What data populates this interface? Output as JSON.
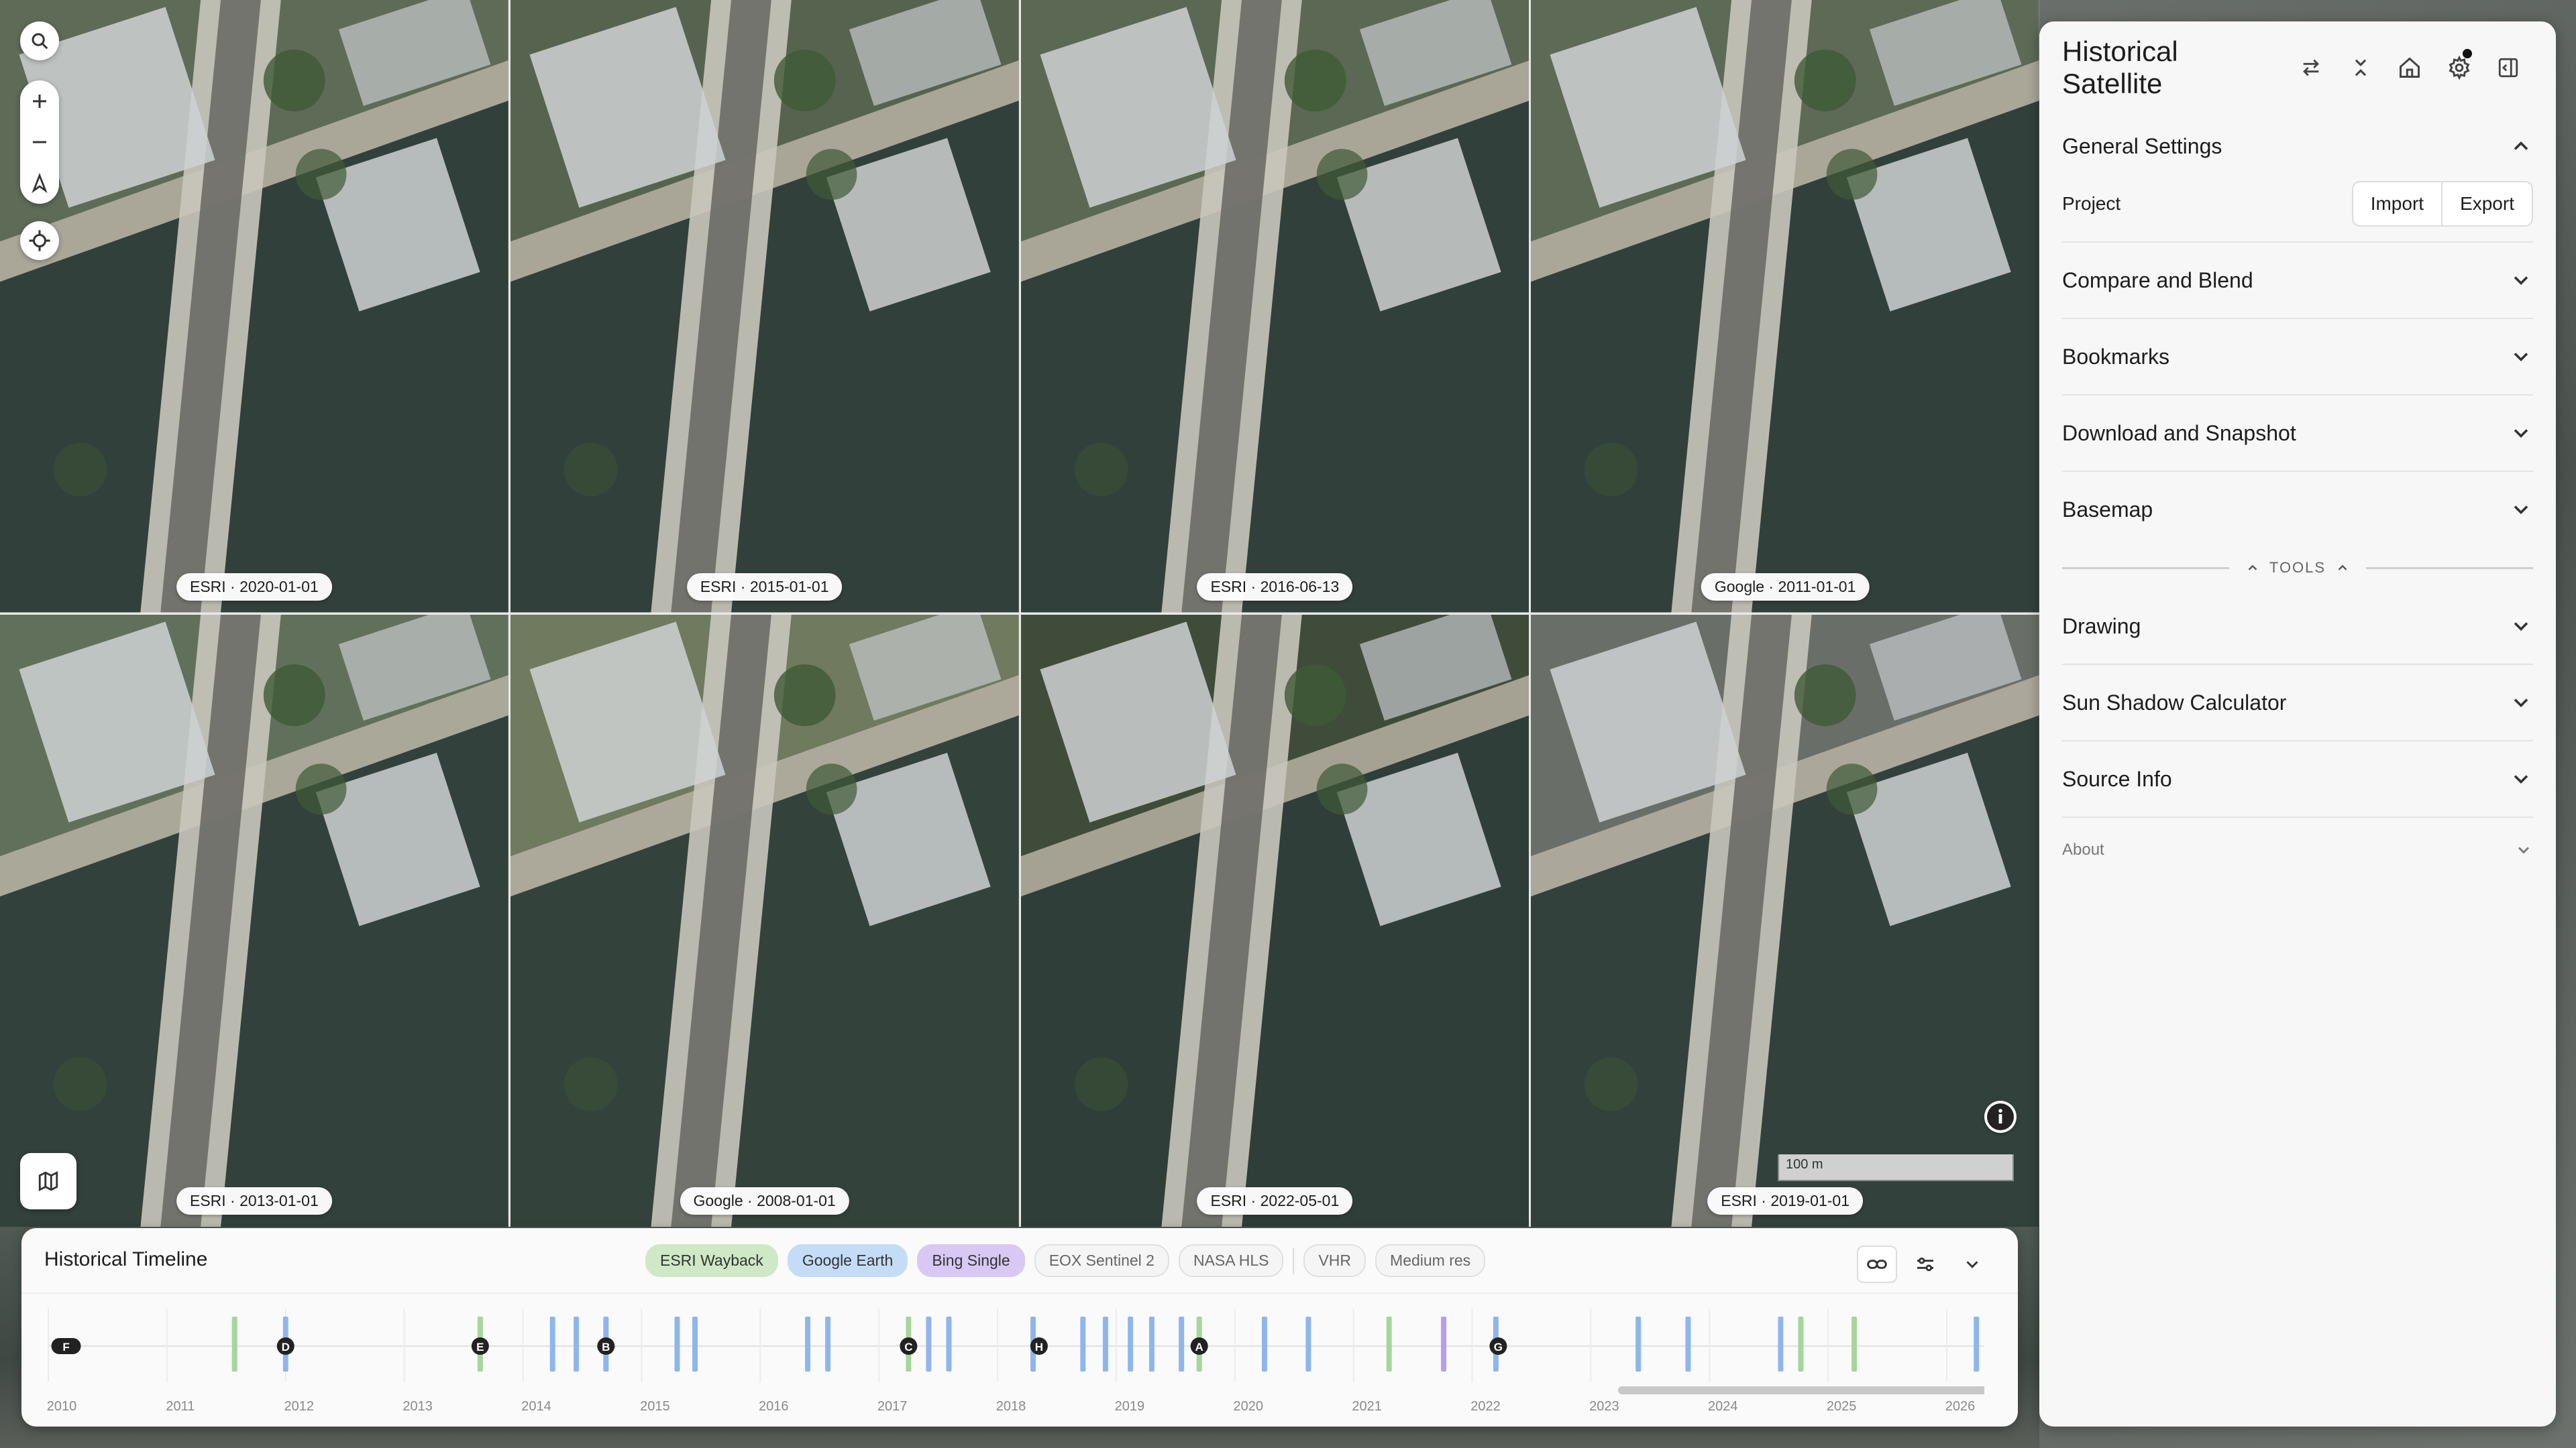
{
  "tiles": [
    {
      "label": "ESRI · 2020-01-01",
      "tone": "#5e6b57"
    },
    {
      "label": "ESRI · 2015-01-01",
      "tone": "#56644f"
    },
    {
      "label": "ESRI · 2016-06-13",
      "tone": "#5b6853"
    },
    {
      "label": "Google · 2011-01-01",
      "tone": "#5d6a56"
    },
    {
      "label": "ESRI · 2013-01-01",
      "tone": "#61705a"
    },
    {
      "label": "Google · 2008-01-01",
      "tone": "#6f7a5e"
    },
    {
      "label": "ESRI · 2022-05-01",
      "tone": "#3f4c3a"
    },
    {
      "label": "ESRI · 2019-01-01",
      "tone": "#6a6e68"
    }
  ],
  "map": {
    "scale_label": "100 m"
  },
  "panel": {
    "title": "Historical Satellite",
    "general_settings": "General Settings",
    "project_label": "Project",
    "import_label": "Import",
    "export_label": "Export",
    "compare_blend": "Compare and Blend",
    "bookmarks": "Bookmarks",
    "download_snapshot": "Download and Snapshot",
    "basemap": "Basemap",
    "tools_label": "TOOLS",
    "drawing": "Drawing",
    "sun_shadow": "Sun Shadow Calculator",
    "source_info": "Source Info",
    "about": "About"
  },
  "timeline": {
    "title": "Historical Timeline",
    "chips": [
      {
        "label": "ESRI Wayback",
        "state": "esri"
      },
      {
        "label": "Google Earth",
        "state": "google"
      },
      {
        "label": "Bing Single",
        "state": "bing"
      },
      {
        "label": "EOX Sentinel 2",
        "state": "off"
      },
      {
        "label": "NASA HLS",
        "state": "off"
      },
      {
        "label": "VHR",
        "state": "off"
      },
      {
        "label": "Medium res",
        "state": "off"
      }
    ],
    "years": [
      "2010",
      "2011",
      "2012",
      "2013",
      "2014",
      "2015",
      "2016",
      "2017",
      "2018",
      "2019",
      "2020",
      "2021",
      "2022",
      "2023",
      "2024",
      "2025",
      "2026"
    ],
    "colors": {
      "esri": "#a6d69a",
      "google": "#8fb6ec",
      "bing": "#b79ef0"
    },
    "events": [
      {
        "t": 2011.57,
        "source": "esri"
      },
      {
        "t": 2012.0,
        "source": "google"
      },
      {
        "t": 2013.64,
        "source": "esri"
      },
      {
        "t": 2014.25,
        "source": "google"
      },
      {
        "t": 2014.45,
        "source": "google"
      },
      {
        "t": 2014.7,
        "source": "google"
      },
      {
        "t": 2015.3,
        "source": "google"
      },
      {
        "t": 2015.45,
        "source": "google"
      },
      {
        "t": 2016.4,
        "source": "google"
      },
      {
        "t": 2016.57,
        "source": "google"
      },
      {
        "t": 2017.25,
        "source": "esri"
      },
      {
        "t": 2017.42,
        "source": "google"
      },
      {
        "t": 2017.59,
        "source": "google"
      },
      {
        "t": 2018.3,
        "source": "google"
      },
      {
        "t": 2018.72,
        "source": "google"
      },
      {
        "t": 2018.91,
        "source": "google"
      },
      {
        "t": 2019.12,
        "source": "google"
      },
      {
        "t": 2019.3,
        "source": "google"
      },
      {
        "t": 2019.55,
        "source": "google"
      },
      {
        "t": 2019.7,
        "source": "esri"
      },
      {
        "t": 2020.25,
        "source": "google"
      },
      {
        "t": 2020.62,
        "source": "google"
      },
      {
        "t": 2021.3,
        "source": "esri"
      },
      {
        "t": 2021.76,
        "source": "bing"
      },
      {
        "t": 2022.2,
        "source": "google"
      },
      {
        "t": 2023.4,
        "source": "google"
      },
      {
        "t": 2023.82,
        "source": "google"
      },
      {
        "t": 2024.6,
        "source": "google"
      },
      {
        "t": 2024.77,
        "source": "esri"
      },
      {
        "t": 2025.22,
        "source": "esri"
      },
      {
        "t": 2026.25,
        "source": "google"
      }
    ],
    "markers": [
      {
        "t": 2010.15,
        "label": "F"
      },
      {
        "t": 2012.0,
        "label": "D"
      },
      {
        "t": 2013.64,
        "label": "E"
      },
      {
        "t": 2014.7,
        "label": "B"
      },
      {
        "t": 2017.25,
        "label": "C"
      },
      {
        "t": 2018.35,
        "label": "H"
      },
      {
        "t": 2019.7,
        "label": "A"
      },
      {
        "t": 2022.22,
        "label": "G"
      }
    ]
  }
}
